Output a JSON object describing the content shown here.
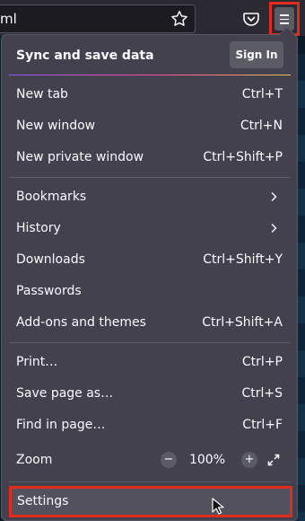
{
  "toolbar": {
    "url_text": "ml",
    "star_icon": "bookmark-star-icon",
    "pocket_icon": "pocket-icon",
    "menu_icon": "hamburger-menu-icon"
  },
  "sync": {
    "title": "Sync and save data",
    "sign_in_label": "Sign In"
  },
  "menu": {
    "new_tab": {
      "label": "New tab",
      "shortcut": "Ctrl+T"
    },
    "new_window": {
      "label": "New window",
      "shortcut": "Ctrl+N"
    },
    "new_private_window": {
      "label": "New private window",
      "shortcut": "Ctrl+Shift+P"
    },
    "bookmarks": {
      "label": "Bookmarks"
    },
    "history": {
      "label": "History"
    },
    "downloads": {
      "label": "Downloads",
      "shortcut": "Ctrl+Shift+Y"
    },
    "passwords": {
      "label": "Passwords"
    },
    "addons": {
      "label": "Add-ons and themes",
      "shortcut": "Ctrl+Shift+A"
    },
    "print": {
      "label": "Print…",
      "shortcut": "Ctrl+P"
    },
    "save_page": {
      "label": "Save page as…",
      "shortcut": "Ctrl+S"
    },
    "find": {
      "label": "Find in page…",
      "shortcut": "Ctrl+F"
    },
    "zoom": {
      "label": "Zoom",
      "minus": "−",
      "value": "100%",
      "plus": "+"
    },
    "settings": {
      "label": "Settings"
    }
  },
  "colors": {
    "highlight_border": "#e22b1c",
    "panel_bg": "#42414d",
    "toolbar_bg": "#2b2a33"
  }
}
